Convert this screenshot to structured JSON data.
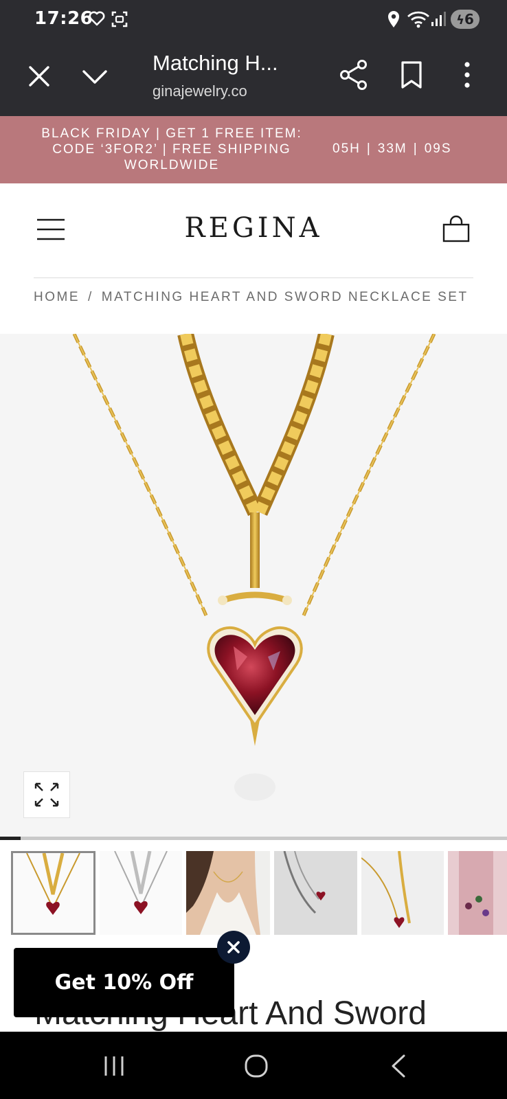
{
  "status_bar": {
    "time": "17:26",
    "battery_level": "6",
    "icons": [
      "heart-outline-icon",
      "screenshot-icon",
      "location-icon",
      "wifi-icon",
      "signal-icon",
      "battery-charging-icon"
    ]
  },
  "browser": {
    "page_title": "Matching H...",
    "url": "ginajewelry.co",
    "buttons": [
      "close-icon",
      "chevron-down-icon",
      "share-icon",
      "bookmark-icon",
      "more-vertical-icon"
    ]
  },
  "promo_banner": {
    "text": "BLACK FRIDAY | GET 1 FREE ITEM: CODE ‘3FOR2’ | FREE SHIPPING WORLDWIDE",
    "hours": "05H",
    "minutes": "33M",
    "seconds": "09S",
    "separator": "|",
    "background": "#b9787c"
  },
  "header": {
    "brand": "REGINA",
    "menu_icon": "hamburger-menu-icon",
    "cart_icon": "shopping-bag-icon"
  },
  "breadcrumb": {
    "home": "HOME",
    "separator": "/",
    "current": "MATCHING HEART AND SWORD NECKLACE SET"
  },
  "gallery": {
    "expand_icon": "expand-icon",
    "progress": 0.04,
    "thumbnails": [
      {
        "name": "gold-necklace-set"
      },
      {
        "name": "silver-necklace-set"
      },
      {
        "name": "model-wearing-necklace"
      },
      {
        "name": "silver-necklace-on-fur"
      },
      {
        "name": "gold-necklace-on-fur"
      },
      {
        "name": "necklace-collection-card"
      }
    ]
  },
  "product": {
    "title": "Matching Heart And Sword"
  },
  "popup": {
    "label": "Get 10% Off",
    "close_icon": "close-icon"
  },
  "nav_bar": {
    "buttons": [
      "recent-apps-icon",
      "home-icon",
      "back-icon"
    ]
  }
}
